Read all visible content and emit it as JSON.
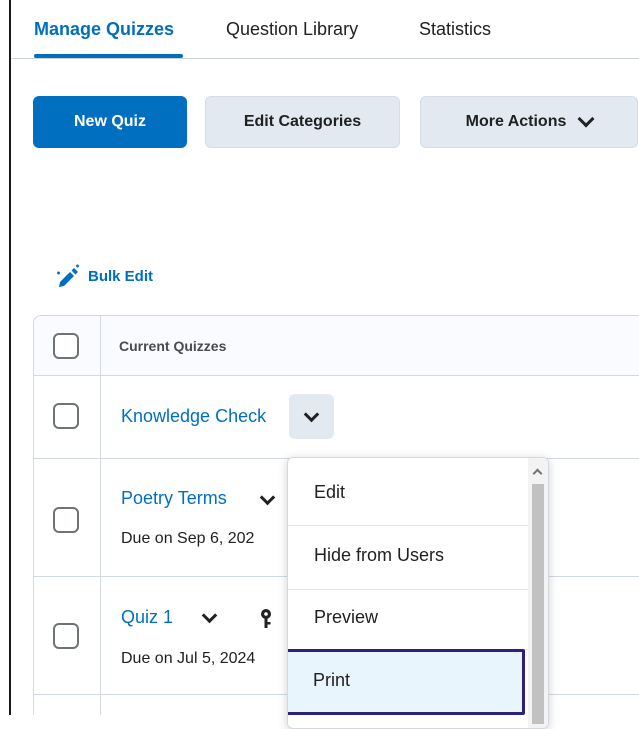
{
  "tabs": [
    {
      "label": "Manage Quizzes",
      "active": true
    },
    {
      "label": "Question Library",
      "active": false
    },
    {
      "label": "Statistics",
      "active": false
    }
  ],
  "toolbar": {
    "new_quiz_label": "New Quiz",
    "edit_categories_label": "Edit Categories",
    "more_actions_label": "More Actions"
  },
  "bulk_edit": {
    "label": "Bulk Edit",
    "icon": "pencil-icon"
  },
  "table": {
    "header_label": "Current Quizzes",
    "rows": [
      {
        "title": "Knowledge Check",
        "due": ""
      },
      {
        "title": "Poetry Terms",
        "due": "Due on Sep 6, 202"
      },
      {
        "title": "Quiz 1",
        "due": "Due on Jul 5, 2024"
      }
    ]
  },
  "context_menu": {
    "items": [
      {
        "label": "Edit"
      },
      {
        "label": "Hide from Users"
      },
      {
        "label": "Preview"
      },
      {
        "label": "Print",
        "highlighted": true
      }
    ]
  },
  "colors": {
    "accent": "#006fbf",
    "button_secondary": "#e3e9f1",
    "focus_outline": "#2b2280",
    "highlight_bg": "#e9f5fc"
  }
}
